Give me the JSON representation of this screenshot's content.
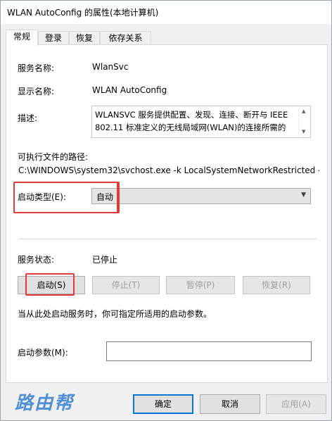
{
  "window": {
    "title": "WLAN AutoConfig 的属性(本地计算机)"
  },
  "tabs": [
    {
      "label": "常规"
    },
    {
      "label": "登录"
    },
    {
      "label": "恢复"
    },
    {
      "label": "依存关系"
    }
  ],
  "general": {
    "service_name_label": "服务名称:",
    "service_name_value": "WlanSvc",
    "display_name_label": "显示名称:",
    "display_name_value": "WLAN AutoConfig",
    "description_label": "描述:",
    "description_value": "WLANSVC 服务提供配置、发现、连接、断开与 IEEE 802.11 标准定义的无线局域网(WLAN)的连接所需的",
    "executable_path_label": "可执行文件的路径:",
    "executable_path_value": "C:\\WINDOWS\\system32\\svchost.exe -k LocalSystemNetworkRestricted -",
    "startup_type_label": "启动类型(E):",
    "startup_type_value": "自动",
    "service_status_label": "服务状态:",
    "service_status_value": "已停止",
    "start_button": "启动(S)",
    "stop_button": "停止(T)",
    "pause_button": "暂停(P)",
    "resume_button": "恢复(R)",
    "hint_text": "当从此处启动服务时，你可指定所适用的启动参数。",
    "start_params_label": "启动参数(M):",
    "start_params_value": ""
  },
  "footer": {
    "watermark": "路由帮",
    "ok_button": "确定",
    "cancel_button": "取消",
    "apply_button": "应用(A)"
  },
  "colors": {
    "highlight": "#e03a3a",
    "watermark": "#4f8fd6",
    "focus_border": "#0078d7"
  }
}
